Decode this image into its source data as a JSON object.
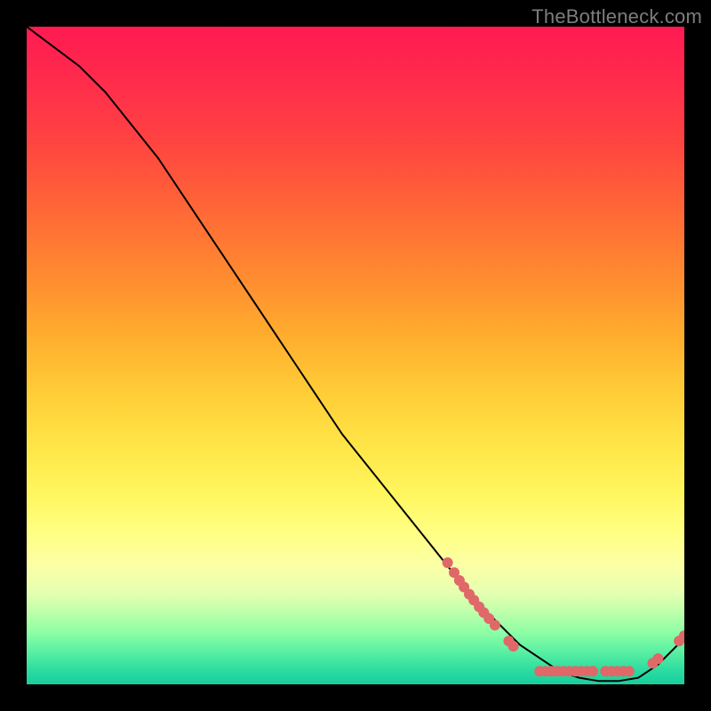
{
  "attribution": "TheBottleneck.com",
  "colors": {
    "gradient_top": "#ff1a52",
    "gradient_bottom": "#18ce9f",
    "curve": "#000000",
    "marker_fill": "#e06868",
    "marker_stroke": "#d94f4f"
  },
  "chart_data": {
    "type": "line",
    "title": "",
    "xlabel": "",
    "ylabel": "",
    "xlim": [
      0,
      100
    ],
    "ylim": [
      0,
      100
    ],
    "grid": false,
    "series": [
      {
        "name": "bottleneck-curve",
        "x": [
          0,
          4,
          8,
          12,
          16,
          20,
          24,
          28,
          32,
          36,
          40,
          44,
          48,
          52,
          56,
          60,
          64,
          68,
          72,
          75,
          78,
          81,
          84,
          87,
          90,
          93,
          96,
          99,
          100
        ],
        "y": [
          100,
          97,
          94,
          90,
          85,
          80,
          74,
          68,
          62,
          56,
          50,
          44,
          38,
          33,
          28,
          23,
          18,
          13,
          9,
          6,
          4,
          2,
          1,
          0.5,
          0.5,
          1,
          3,
          6,
          7
        ]
      }
    ],
    "markers": [
      {
        "name": "cluster-descent",
        "points": [
          {
            "x": 64.0,
            "y": 18.5
          },
          {
            "x": 65.0,
            "y": 17.0
          },
          {
            "x": 65.8,
            "y": 15.8
          },
          {
            "x": 66.5,
            "y": 14.8
          },
          {
            "x": 67.3,
            "y": 13.7
          },
          {
            "x": 68.0,
            "y": 12.8
          },
          {
            "x": 68.8,
            "y": 11.8
          },
          {
            "x": 69.5,
            "y": 10.9
          },
          {
            "x": 70.3,
            "y": 10.0
          },
          {
            "x": 71.2,
            "y": 9.0
          }
        ]
      },
      {
        "name": "cluster-dip-pair",
        "points": [
          {
            "x": 73.3,
            "y": 6.6
          },
          {
            "x": 74.0,
            "y": 5.8
          }
        ]
      },
      {
        "name": "cluster-valley-label-row",
        "points": [
          {
            "x": 78.0,
            "y": 2.0
          },
          {
            "x": 78.9,
            "y": 2.0
          },
          {
            "x": 79.8,
            "y": 2.0
          },
          {
            "x": 80.7,
            "y": 2.0
          },
          {
            "x": 81.6,
            "y": 2.0
          },
          {
            "x": 82.5,
            "y": 2.0
          },
          {
            "x": 83.4,
            "y": 2.0
          },
          {
            "x": 84.3,
            "y": 2.0
          },
          {
            "x": 85.2,
            "y": 2.0
          },
          {
            "x": 86.1,
            "y": 2.0
          },
          {
            "x": 88.0,
            "y": 2.0
          },
          {
            "x": 88.9,
            "y": 2.0
          },
          {
            "x": 89.8,
            "y": 2.0
          },
          {
            "x": 90.7,
            "y": 2.0
          },
          {
            "x": 91.6,
            "y": 2.0
          }
        ]
      },
      {
        "name": "cluster-rise",
        "points": [
          {
            "x": 95.2,
            "y": 3.2
          },
          {
            "x": 96.0,
            "y": 3.9
          }
        ]
      },
      {
        "name": "cluster-top-right",
        "points": [
          {
            "x": 99.2,
            "y": 6.6
          },
          {
            "x": 100.0,
            "y": 7.4
          }
        ]
      }
    ]
  }
}
